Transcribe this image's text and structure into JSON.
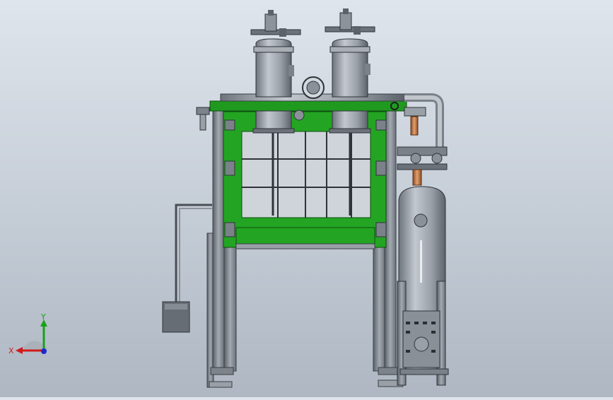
{
  "viewport": {
    "background_top": "#dfe5ec",
    "background_bottom": "#aeb7c2"
  },
  "model": {
    "frame_color": "#1f9a1f",
    "steel_color": "#9aa0a8",
    "copper_color": "#c8804a"
  },
  "triad": {
    "x_label": "X",
    "y_label": "Y",
    "x_color": "#d11a1a",
    "y_color": "#1aa11a",
    "z_color": "#1a2ad1"
  }
}
